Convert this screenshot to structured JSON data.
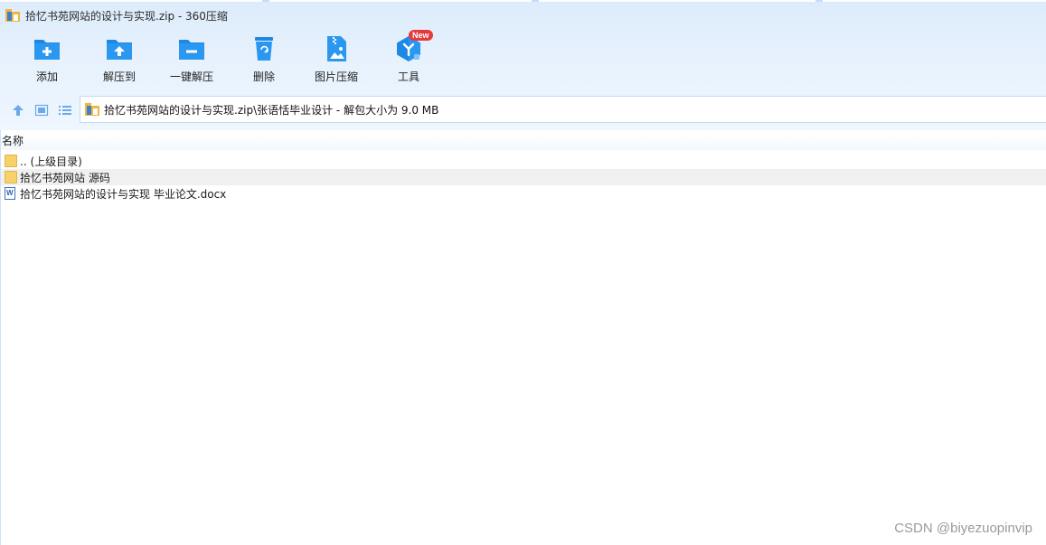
{
  "window": {
    "title": "拾忆书苑网站的设计与实现.zip - 360压缩"
  },
  "toolbar": {
    "items": [
      {
        "label": "添加",
        "icon": "add-folder-icon"
      },
      {
        "label": "解压到",
        "icon": "extract-to-icon"
      },
      {
        "label": "一键解压",
        "icon": "one-click-extract-icon"
      },
      {
        "label": "删除",
        "icon": "recycle-bin-icon"
      },
      {
        "label": "图片压缩",
        "icon": "image-compress-icon"
      },
      {
        "label": "工具",
        "icon": "tools-icon",
        "badge": "New"
      }
    ]
  },
  "nav": {
    "icons": [
      "up-arrow-icon",
      "view-icon",
      "list-icon"
    ]
  },
  "address": {
    "path": "拾忆书苑网站的设计与实现.zip\\张语恬毕业设计 - 解包大小为 9.0 MB"
  },
  "list": {
    "column": "名称",
    "rows": [
      {
        "name": ".. (上级目录)",
        "type": "folder"
      },
      {
        "name": "拾忆书苑网站 源码",
        "type": "folder"
      },
      {
        "name": "拾忆书苑网站的设计与实现 毕业论文.docx",
        "type": "docx"
      }
    ]
  },
  "watermark": "CSDN @biyezuopinvip",
  "colors": {
    "accent": "#1e88e5",
    "badge": "#e6393b",
    "folder": "#f7d26a"
  }
}
